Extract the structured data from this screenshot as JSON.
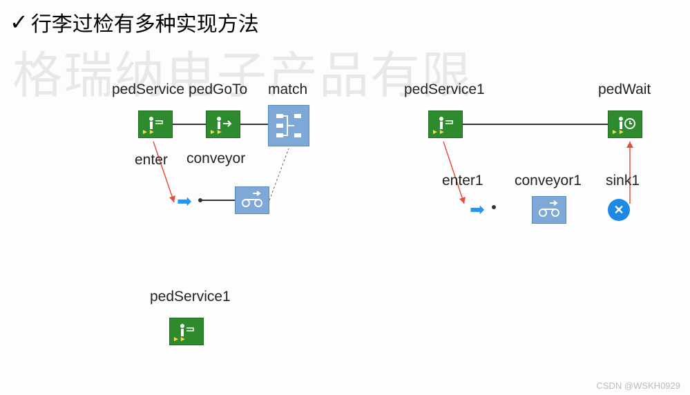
{
  "title": "行李过检有多种实现方法",
  "watermark_text": "格瑞纳电子产品有限",
  "attribution": "CSDN @WSKH0929",
  "diagramA": {
    "pedService": "pedService",
    "pedGoTo": "pedGoTo",
    "match": "match",
    "enter": "enter",
    "conveyor": "conveyor"
  },
  "diagramB": {
    "pedService1": "pedService1",
    "pedWait": "pedWait",
    "enter1": "enter1",
    "conveyor1": "conveyor1",
    "sink1": "sink1"
  },
  "diagramC": {
    "pedService1": "pedService1"
  },
  "icons": {
    "ped_service": "pedestrian-service",
    "ped_goto": "pedestrian-goto",
    "ped_wait": "pedestrian-wait",
    "match": "match-block",
    "conveyor": "conveyor-block",
    "enter": "enter-arrow",
    "sink": "sink-cross"
  }
}
